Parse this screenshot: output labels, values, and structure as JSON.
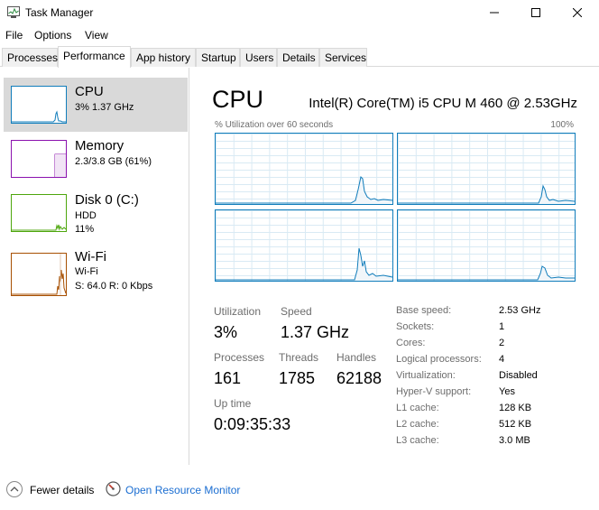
{
  "window": {
    "title": "Task Manager"
  },
  "menu": [
    "File",
    "Options",
    "View"
  ],
  "tabs": [
    "Processes",
    "Performance",
    "App history",
    "Startup",
    "Users",
    "Details",
    "Services"
  ],
  "sidebar": [
    {
      "name": "CPU",
      "line1": "3%  1.37 GHz",
      "line2": "",
      "line3": "",
      "color": "#117dbb"
    },
    {
      "name": "Memory",
      "line1": "2.3/3.8 GB (61%)",
      "line2": "",
      "line3": "",
      "color": "#8b12ae"
    },
    {
      "name": "Disk 0 (C:)",
      "line1": "HDD",
      "line2": "11%",
      "line3": "",
      "color": "#4da60c"
    },
    {
      "name": "Wi-Fi",
      "line1": "Wi-Fi",
      "line2": "S: 64.0  R: 0 Kbps",
      "line3": "",
      "color": "#a74f01"
    }
  ],
  "main": {
    "title": "CPU",
    "model": "Intel(R) Core(TM) i5 CPU M 460 @ 2.53GHz",
    "graph_label": "% Utilization over 60 seconds",
    "graph_max": "100%"
  },
  "stats": {
    "utilization_label": "Utilization",
    "utilization": "3%",
    "speed_label": "Speed",
    "speed": "1.37 GHz",
    "processes_label": "Processes",
    "processes": "161",
    "threads_label": "Threads",
    "threads": "1785",
    "handles_label": "Handles",
    "handles": "62188",
    "uptime_label": "Up time",
    "uptime": "0:09:35:33"
  },
  "specs": [
    {
      "label": "Base speed:",
      "value": "2.53 GHz"
    },
    {
      "label": "Sockets:",
      "value": "1"
    },
    {
      "label": "Cores:",
      "value": "2"
    },
    {
      "label": "Logical processors:",
      "value": "4"
    },
    {
      "label": "Virtualization:",
      "value": "Disabled"
    },
    {
      "label": "Hyper-V support:",
      "value": "Yes"
    },
    {
      "label": "L1 cache:",
      "value": "128 KB"
    },
    {
      "label": "L2 cache:",
      "value": "512 KB"
    },
    {
      "label": "L3 cache:",
      "value": "3.0 MB"
    }
  ],
  "footer": {
    "fewer_details": "Fewer details",
    "resource_monitor": "Open Resource Monitor"
  },
  "colors": {
    "cpu": "#117dbb",
    "memory": "#8b12ae",
    "disk": "#4da60c",
    "wifi": "#a74f01",
    "link": "#1a6dd1"
  }
}
